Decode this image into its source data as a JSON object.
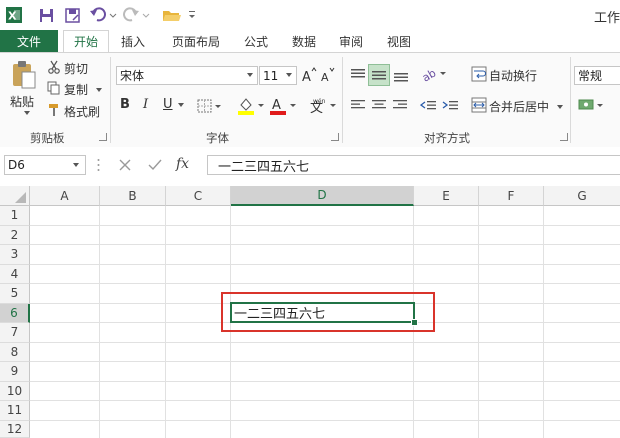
{
  "window": {
    "title_fragment": "工作"
  },
  "tabs": [
    {
      "label": "文件"
    },
    {
      "label": "开始"
    },
    {
      "label": "插入"
    },
    {
      "label": "页面布局"
    },
    {
      "label": "公式"
    },
    {
      "label": "数据"
    },
    {
      "label": "审阅"
    },
    {
      "label": "视图"
    }
  ],
  "ribbon": {
    "clipboard": {
      "paste": "粘贴",
      "cut": "剪切",
      "copy": "复制",
      "format_painter": "格式刷",
      "group_label": "剪贴板"
    },
    "font": {
      "font_name": "宋体",
      "font_size": "11",
      "bold": "B",
      "italic": "I",
      "underline": "U",
      "group_label": "字体"
    },
    "alignment": {
      "wrap_text": "自动换行",
      "merge_center": "合并后居中",
      "group_label": "对齐方式"
    },
    "number": {
      "format": "常规"
    }
  },
  "formula_bar": {
    "name_box": "D6",
    "fx": "fx",
    "content": "一二三四五六七"
  },
  "sheet": {
    "columns": [
      "A",
      "B",
      "C",
      "D",
      "E",
      "F",
      "G"
    ],
    "rows": [
      "1",
      "2",
      "3",
      "4",
      "5",
      "6",
      "7",
      "8",
      "9",
      "10",
      "11",
      "12"
    ],
    "selected_cell": "D6",
    "cell_d6": "一二三四五六七"
  },
  "colors": {
    "excel_green": "#217346",
    "highlight_red": "#d9342b",
    "selection_green": "#217346"
  }
}
